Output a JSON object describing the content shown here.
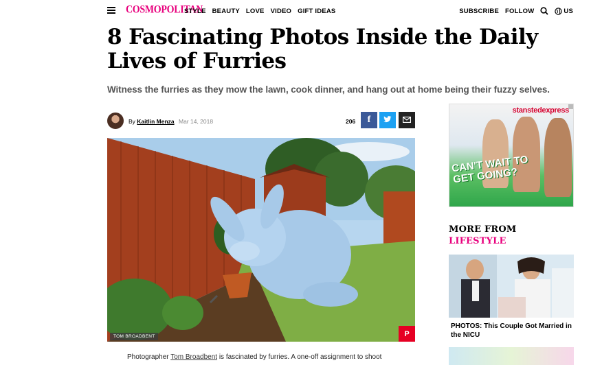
{
  "nav": {
    "logo": "COSMOPOLITAN",
    "links": [
      "STYLE",
      "BEAUTY",
      "LOVE",
      "VIDEO",
      "GIFT IDEAS"
    ],
    "subscribe": "SUBSCRIBE",
    "follow": "FOLLOW",
    "region": "US"
  },
  "article": {
    "headline": "8 Fascinating Photos Inside the Daily Lives of Furries",
    "dek": "Witness the furries as they mow the lawn, cook dinner, and hang out at home being their fuzzy selves.",
    "byline_prefix": "By",
    "author": "Kaitlin Menza",
    "date": "Mar 14, 2018",
    "share_count": "206",
    "photo_credit": "TOM BROADBENT",
    "body_start": "Photographer",
    "body_link": "Tom Broadbent",
    "body_rest": "is fascinated by furries. A one-off assignment to shoot"
  },
  "share": {
    "facebook_glyph": "f",
    "pinterest_glyph": "P"
  },
  "ad": {
    "brand": "stanstedexpress",
    "headline": "CAN'T WAIT TO GET GOING?"
  },
  "rail": {
    "more_from": "MORE FROM",
    "section": "LIFESTYLE",
    "story_caption": "PHOTOS: This Couple Got Married in the NICU"
  },
  "colors": {
    "brand_pink": "#e8007d",
    "facebook": "#3b5998",
    "twitter": "#1da1f2",
    "pinterest": "#e60023"
  }
}
